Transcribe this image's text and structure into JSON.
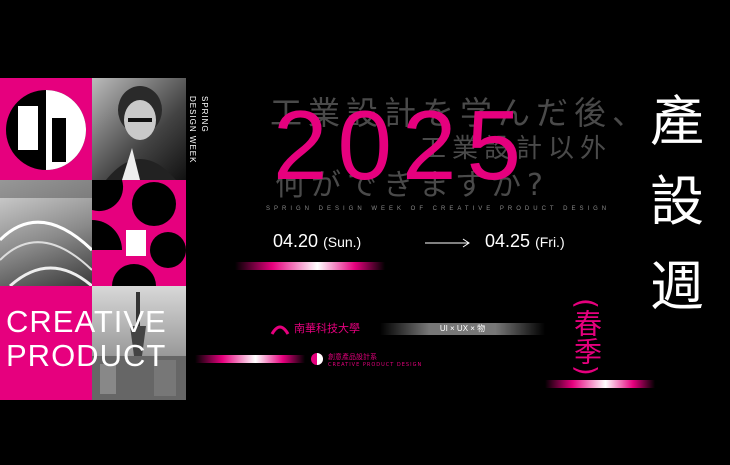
{
  "left_panel": {
    "vertical_text_1": "SPRING",
    "vertical_text_2": "DESIGN WEEK",
    "creative_line1": "CREATIVE",
    "creative_line2": "PRODUCT"
  },
  "headline": {
    "year": "2025",
    "faint_line1": "工業設計を学んだ後、",
    "faint_line2": "何ができますか?",
    "faint_line3": "工業設計以外",
    "subtitle": "SPRIGN DESIGN WEEK OF CREATIVE PRODUCT DESIGN"
  },
  "dates": {
    "start": "04.20",
    "start_day": "(Sun.)",
    "end": "04.25",
    "end_day": "(Fri.)"
  },
  "title_vertical": [
    "產",
    "設",
    "週"
  ],
  "season": "(春季)",
  "logos": {
    "university": "南華科技大學",
    "department": "創意產品設計系",
    "department_en": "CREATIVE PRODUCT DESIGN",
    "tag": "UI × UX × 物"
  },
  "colors": {
    "accent": "#e6007e",
    "background": "#000000"
  }
}
